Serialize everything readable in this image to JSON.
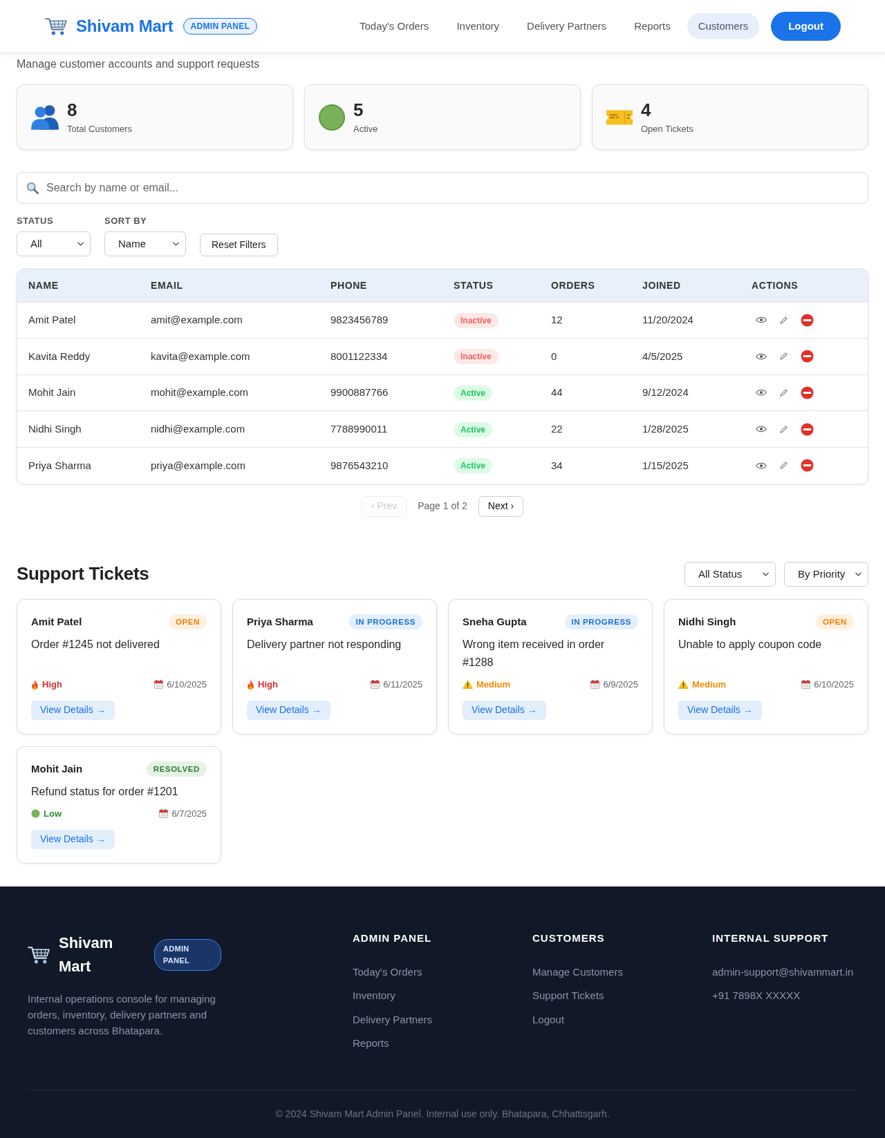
{
  "header": {
    "brand": "Shivam Mart",
    "badge": "ADMIN PANEL",
    "nav": [
      {
        "label": "Today's Orders",
        "selected": false
      },
      {
        "label": "Inventory",
        "selected": false
      },
      {
        "label": "Delivery Partners",
        "selected": false
      },
      {
        "label": "Reports",
        "selected": false
      },
      {
        "label": "Customers",
        "selected": true
      }
    ],
    "logout": "Logout"
  },
  "subtitle": "Manage customer accounts and support requests",
  "stats": [
    {
      "kind": "customers",
      "value": "8",
      "label": "Total Customers"
    },
    {
      "kind": "active",
      "value": "5",
      "label": "Active"
    },
    {
      "kind": "tickets",
      "value": "4",
      "label": "Open Tickets"
    }
  ],
  "search": {
    "placeholder": "Search by name or email..."
  },
  "filters": [
    {
      "label": "STATUS",
      "value": "All"
    },
    {
      "label": "SORT BY",
      "value": "Name"
    }
  ],
  "reset_button": "Reset Filters",
  "table": {
    "columns": [
      "NAME",
      "EMAIL",
      "PHONE",
      "STATUS",
      "ORDERS",
      "JOINED",
      "ACTIONS"
    ],
    "rows": [
      {
        "name": "Amit Patel",
        "email": "amit@example.com",
        "phone": "9823456789",
        "status": {
          "kind": "inactive",
          "label": "Inactive"
        },
        "orders": "12",
        "joined": "11/20/2024"
      },
      {
        "name": "Kavita Reddy",
        "email": "kavita@example.com",
        "phone": "8001122334",
        "status": {
          "kind": "inactive",
          "label": "Inactive"
        },
        "orders": "0",
        "joined": "4/5/2025"
      },
      {
        "name": "Mohit Jain",
        "email": "mohit@example.com",
        "phone": "9900887766",
        "status": {
          "kind": "active",
          "label": "Active"
        },
        "orders": "44",
        "joined": "9/12/2024"
      },
      {
        "name": "Nidhi Singh",
        "email": "nidhi@example.com",
        "phone": "7788990011",
        "status": {
          "kind": "active",
          "label": "Active"
        },
        "orders": "22",
        "joined": "1/28/2025"
      },
      {
        "name": "Priya Sharma",
        "email": "priya@example.com",
        "phone": "9876543210",
        "status": {
          "kind": "active",
          "label": "Active"
        },
        "orders": "34",
        "joined": "1/15/2025"
      }
    ]
  },
  "pagination": {
    "prev": {
      "label": "‹ Prev",
      "disabled": true
    },
    "info": "Page 1 of 2",
    "next": {
      "label": "Next ›",
      "disabled": false
    }
  },
  "tickets": {
    "title": "Support Tickets",
    "filters": [
      "All Status",
      "By Priority"
    ],
    "items": [
      {
        "customer": "Amit Patel",
        "status": {
          "kind": "open",
          "label": "OPEN"
        },
        "subject": "Order #1245 not delivered",
        "priority": {
          "kind": "high",
          "label": "High"
        },
        "date": "6/10/2025",
        "button": "View Details →"
      },
      {
        "customer": "Priya Sharma",
        "status": {
          "kind": "in_progress",
          "label": "IN PROGRESS"
        },
        "subject": "Delivery partner not responding",
        "priority": {
          "kind": "high",
          "label": "High"
        },
        "date": "6/11/2025",
        "button": "View Details →"
      },
      {
        "customer": "Sneha Gupta",
        "status": {
          "kind": "in_progress",
          "label": "IN PROGRESS"
        },
        "subject": "Wrong item received in order #1288",
        "priority": {
          "kind": "medium",
          "label": "Medium"
        },
        "date": "6/9/2025",
        "button": "View Details →"
      },
      {
        "customer": "Nidhi Singh",
        "status": {
          "kind": "open",
          "label": "OPEN"
        },
        "subject": "Unable to apply coupon code",
        "priority": {
          "kind": "medium",
          "label": "Medium"
        },
        "date": "6/10/2025",
        "button": "View Details →"
      },
      {
        "customer": "Mohit Jain",
        "status": {
          "kind": "resolved",
          "label": "RESOLVED"
        },
        "subject": "Refund status for order #1201",
        "priority": {
          "kind": "low",
          "label": "Low"
        },
        "date": "6/7/2025",
        "button": "View Details →"
      }
    ]
  },
  "footer": {
    "brand": "Shivam Mart",
    "badge": "ADMIN PANEL",
    "description": "Internal operations console for managing orders, inventory, delivery partners and customers across Bhatapara.",
    "columns": [
      {
        "title": "ADMIN PANEL",
        "links": [
          "Today's Orders",
          "Inventory",
          "Delivery Partners",
          "Reports"
        ]
      },
      {
        "title": "CUSTOMERS",
        "links": [
          "Manage Customers",
          "Support Tickets",
          "Logout"
        ]
      },
      {
        "title": "INTERNAL SUPPORT",
        "links": [
          "admin-support@shivammart.in",
          "+91 7898X XXXXX"
        ]
      }
    ],
    "copyright": "© 2024 Shivam Mart Admin Panel. Internal use only. Bhatapara, Chhattisgarh."
  }
}
